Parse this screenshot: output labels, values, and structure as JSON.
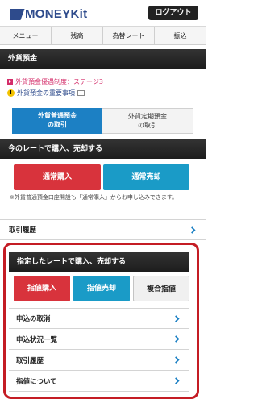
{
  "header": {
    "logo_text": "MONEYKit",
    "login_label": "ログアウト"
  },
  "nav": {
    "items": [
      "メニュー",
      "残高",
      "為替レート",
      "振込"
    ]
  },
  "page_title": "外貨預金",
  "info": {
    "insurance_label": "外貨預金優遇制度：ステージ3",
    "important_label": "外貨預金の重要事項",
    "warn_symbol": "!"
  },
  "tabs": [
    {
      "line1": "外貨普通預金",
      "line2": "の取引"
    },
    {
      "line1": "外貨定期預金",
      "line2": "の取引"
    }
  ],
  "section1": {
    "title": "今のレートで購入、売却する",
    "buy_label": "通常購入",
    "sell_label": "通常売却",
    "note": "※外貨普通預金口座開設も「通常購入」からお申し込みできます。",
    "history_label": "取引履歴"
  },
  "section2": {
    "title": "指定したレートで購入、売却する",
    "buy_label": "指値購入",
    "sell_label": "指値売却",
    "combo_label": "複合指値",
    "rows": [
      "申込の取消",
      "申込状況一覧",
      "取引履歴",
      "指値について"
    ]
  },
  "colors": {
    "accent_blue": "#1c80c4",
    "buy_red": "#d8333c",
    "sell_blue": "#1a9bc7",
    "highlight_red": "#c41c24"
  }
}
